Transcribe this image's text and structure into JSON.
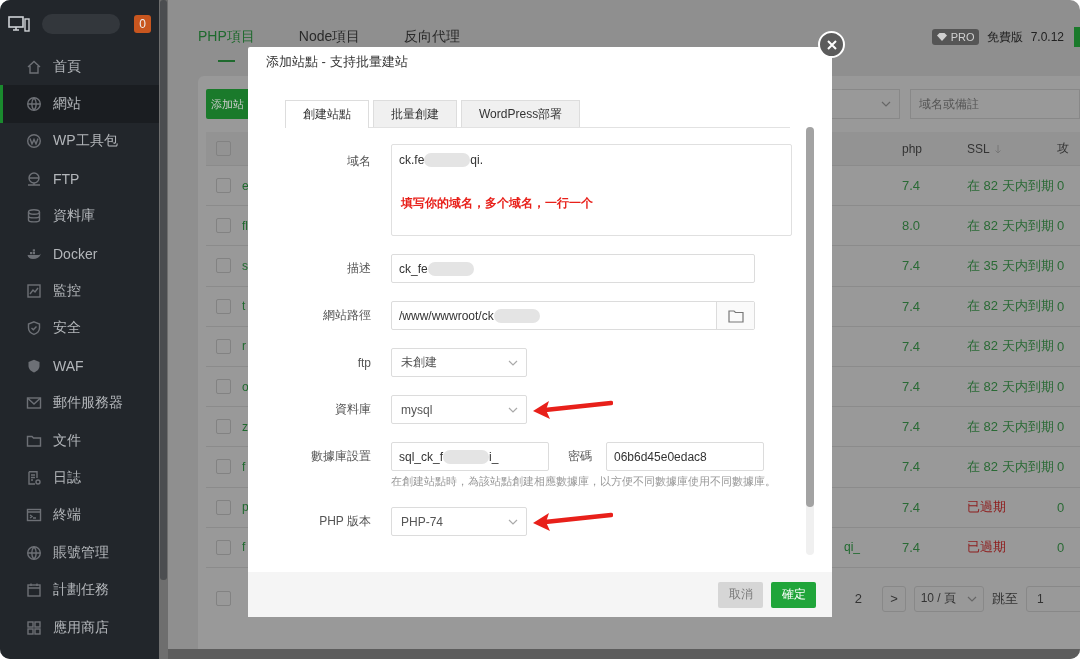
{
  "sidebar": {
    "badge": "0",
    "items": [
      {
        "label": "首頁",
        "kind": "home",
        "selected": false
      },
      {
        "label": "網站",
        "kind": "globe",
        "selected": true
      },
      {
        "label": "WP工具包",
        "kind": "circle",
        "selected": false
      },
      {
        "label": "FTP",
        "kind": "server",
        "selected": false
      },
      {
        "label": "資料庫",
        "kind": "database",
        "selected": false
      },
      {
        "label": "Docker",
        "kind": "whale",
        "selected": false
      },
      {
        "label": "監控",
        "kind": "chart",
        "selected": false
      },
      {
        "label": "安全",
        "kind": "shield",
        "selected": false
      },
      {
        "label": "WAF",
        "kind": "shieldfilled",
        "selected": false
      },
      {
        "label": "郵件服務器",
        "kind": "mail",
        "selected": false
      },
      {
        "label": "文件",
        "kind": "folder",
        "selected": false
      },
      {
        "label": "日誌",
        "kind": "document",
        "selected": false
      },
      {
        "label": "終端",
        "kind": "terminal",
        "selected": false
      },
      {
        "label": "賬號管理",
        "kind": "globe",
        "selected": false
      },
      {
        "label": "計劃任務",
        "kind": "calendar",
        "selected": false
      },
      {
        "label": "應用商店",
        "kind": "grid",
        "selected": false
      }
    ]
  },
  "top_tabs": [
    {
      "label": "PHP項目",
      "selected": true
    },
    {
      "label": "Node項目",
      "selected": false
    },
    {
      "label": "反向代理",
      "selected": false
    }
  ],
  "header_right": {
    "badge": "PRO",
    "edition": "免費版",
    "version": "7.0.12"
  },
  "toolbar": {
    "add_button": "添加站",
    "search_placeholder": "域名或備註"
  },
  "table": {
    "select_all_checked": false,
    "columns": [
      "php",
      "SSL",
      "攻"
    ],
    "rows": [
      {
        "checked": false,
        "name": "e",
        "php": "7.4",
        "ssl": "在 82 天内到期",
        "expired": false,
        "attacks": "0"
      },
      {
        "checked": false,
        "name": "fl",
        "php": "8.0",
        "ssl": "在 82 天内到期",
        "expired": false,
        "attacks": "0"
      },
      {
        "checked": false,
        "name": "s",
        "php": "7.4",
        "ssl": "在 35 天内到期",
        "expired": false,
        "attacks": "0"
      },
      {
        "checked": false,
        "name": "t",
        "php": "7.4",
        "ssl": "在 82 天内到期",
        "expired": false,
        "attacks": "0"
      },
      {
        "checked": false,
        "name": "r",
        "php": "7.4",
        "ssl": "在 82 天内到期",
        "expired": false,
        "attacks": "0"
      },
      {
        "checked": false,
        "name": "o",
        "php": "7.4",
        "ssl": "在 82 天内到期",
        "expired": false,
        "attacks": "0"
      },
      {
        "checked": false,
        "name": "z",
        "php": "7.4",
        "ssl": "在 82 天内到期",
        "expired": false,
        "attacks": "0"
      },
      {
        "checked": false,
        "name": "f",
        "php": "7.4",
        "ssl": "在 82 天内到期",
        "expired": false,
        "attacks": "0"
      },
      {
        "checked": false,
        "name": "p",
        "php": "7.4",
        "ssl": "已過期",
        "expired": true,
        "attacks": "0"
      },
      {
        "checked": false,
        "name": "f",
        "name_end": "qi_",
        "php": "7.4",
        "ssl": "已過期",
        "expired": true,
        "attacks": "0"
      }
    ]
  },
  "pagination": {
    "checked": false,
    "page": "2",
    "next": ">",
    "per_page": "10 / 頁",
    "jump_label": "跳至",
    "jump_value": "1"
  },
  "dialog": {
    "title": "添加站點 - 支持批量建站",
    "tabs": [
      {
        "label": "創建站點",
        "selected": true
      },
      {
        "label": "批量創建",
        "selected": false
      },
      {
        "label": "WordPress部署",
        "selected": false
      }
    ],
    "domain": {
      "label": "域名",
      "value_start": "ck.fe",
      "value_end": "qi.",
      "annotation": "填写你的域名，多个域名，一行一个"
    },
    "description": {
      "label": "描述",
      "value_start": "ck_fe"
    },
    "path": {
      "label": "網站路徑",
      "value_start": "/www/wwwroot/ck"
    },
    "ftp": {
      "label": "ftp",
      "value": "未創建"
    },
    "database": {
      "label": "資料庫",
      "value": "mysql",
      "arrow": true
    },
    "db_settings": {
      "label": "數據庫設置",
      "user_start": "sql_ck_f",
      "user_end": "i_",
      "password_label": "密碼",
      "password": "06b6d45e0edac8",
      "hint": "在創建站點時，為該站點創建相應數據庫，以方便不同數據庫使用不同數據庫。"
    },
    "php": {
      "label": "PHP 版本",
      "value": "PHP-74",
      "arrow": true
    },
    "buttons": [
      {
        "label": "取消",
        "disabled": true
      },
      {
        "label": "確定",
        "disabled": false
      }
    ]
  }
}
